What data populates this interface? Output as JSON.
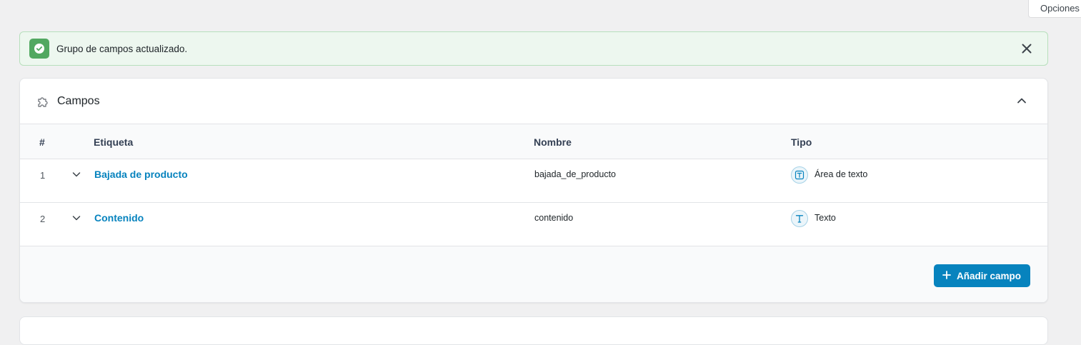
{
  "screen_options": {
    "label": "Opciones"
  },
  "notice": {
    "message": "Grupo de campos actualizado.",
    "status": "success",
    "color": "#52a861",
    "icons": {
      "status": "check-icon",
      "dismiss": "close-icon"
    }
  },
  "fields_panel": {
    "title": "Campos",
    "icon": "puzzle-icon",
    "toggle_icon": "chevron-up-icon",
    "columns": [
      "#",
      "Etiqueta",
      "Nombre",
      "Tipo"
    ],
    "rows": [
      {
        "number": "1",
        "label": "Bajada de producto",
        "name": "bajada_de_producto",
        "type": "Área de texto",
        "type_icon": "textarea-icon"
      },
      {
        "number": "2",
        "label": "Contenido",
        "name": "contenido",
        "type": "Texto",
        "type_icon": "text-icon"
      }
    ],
    "add_button": {
      "label": "Añadir campo",
      "icon": "plus-icon"
    },
    "accent_color": "#0783be"
  }
}
